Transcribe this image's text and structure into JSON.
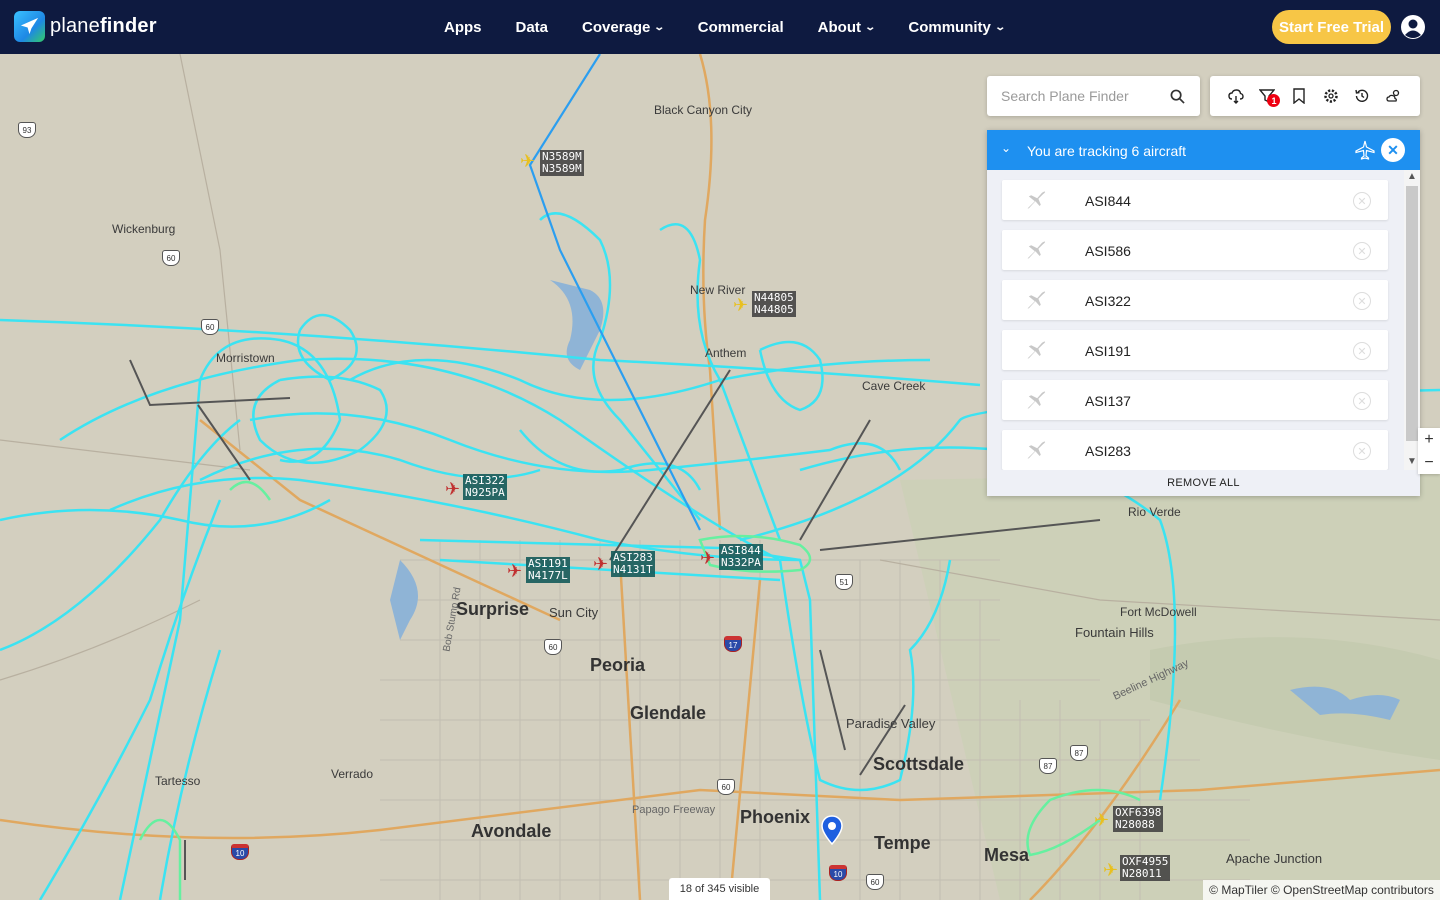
{
  "brand": {
    "name_light": "plane",
    "name_bold": "finder"
  },
  "nav": [
    {
      "label": "Apps",
      "dropdown": false
    },
    {
      "label": "Data",
      "dropdown": false
    },
    {
      "label": "Coverage",
      "dropdown": true
    },
    {
      "label": "Commercial",
      "dropdown": false
    },
    {
      "label": "About",
      "dropdown": true
    },
    {
      "label": "Community",
      "dropdown": true
    }
  ],
  "header": {
    "trial_label": "Start Free Trial"
  },
  "search": {
    "placeholder": "Search Plane Finder"
  },
  "toolbar": {
    "filter_badge": "1",
    "icons": [
      "cloud-icon",
      "filter-icon",
      "bookmark-icon",
      "settings-icon",
      "history-icon",
      "weather-icon"
    ]
  },
  "tracking": {
    "title": "You are tracking 6 aircraft",
    "items": [
      "ASI844",
      "ASI586",
      "ASI322",
      "ASI191",
      "ASI137",
      "ASI283"
    ],
    "remove_all": "REMOVE ALL"
  },
  "zoom": {
    "in": "+",
    "out": "−"
  },
  "map": {
    "places": [
      {
        "name": "Black Canyon City",
        "type": "town"
      },
      {
        "name": "Wickenburg",
        "type": "town"
      },
      {
        "name": "New River",
        "type": "town"
      },
      {
        "name": "Anthem",
        "type": "town"
      },
      {
        "name": "Morristown",
        "type": "town"
      },
      {
        "name": "Cave Creek",
        "type": "town"
      },
      {
        "name": "Rio Verde",
        "type": "town"
      },
      {
        "name": "Fort McDowell",
        "type": "town"
      },
      {
        "name": "Fountain Hills",
        "type": "town"
      },
      {
        "name": "Surprise",
        "type": "city"
      },
      {
        "name": "Sun City",
        "type": "town"
      },
      {
        "name": "Peoria",
        "type": "city"
      },
      {
        "name": "Glendale",
        "type": "city"
      },
      {
        "name": "Paradise Valley",
        "type": "town"
      },
      {
        "name": "Scottsdale",
        "type": "city"
      },
      {
        "name": "Tartesso",
        "type": "town"
      },
      {
        "name": "Verrado",
        "type": "town"
      },
      {
        "name": "Avondale",
        "type": "city"
      },
      {
        "name": "Phoenix",
        "type": "city"
      },
      {
        "name": "Tempe",
        "type": "city"
      },
      {
        "name": "Mesa",
        "type": "city"
      },
      {
        "name": "Apache Junction",
        "type": "town"
      },
      {
        "name": "Papago Freeway",
        "type": "road"
      },
      {
        "name": "Beeline Highway",
        "type": "road"
      },
      {
        "name": "Bob Stump Rd",
        "type": "road"
      }
    ],
    "shields": [
      "93",
      "60",
      "60",
      "51",
      "17",
      "60",
      "87",
      "87",
      "10",
      "10",
      "60",
      "60"
    ],
    "aircraft": [
      {
        "callsign": "N3589M",
        "reg": "N3589M"
      },
      {
        "callsign": "N44805",
        "reg": "N44805"
      },
      {
        "callsign": "ASI322",
        "reg": "N925PA"
      },
      {
        "callsign": "ASI283",
        "reg": "N4131T"
      },
      {
        "callsign": "ASI191",
        "reg": "N4177L"
      },
      {
        "callsign": "ASI844",
        "reg": "N332PA"
      },
      {
        "callsign": "OXF6398",
        "reg": "N28088"
      },
      {
        "callsign": "OXF4955",
        "reg": "N28011"
      }
    ],
    "visible_count": "18 of 345 visible",
    "attribution": "© MapTiler © OpenStreetMap contributors"
  },
  "colors": {
    "header_bg": "#0e1a40",
    "accent": "#1e90f0",
    "trial": "#f7c646",
    "track": "#33e5f5",
    "track_green": "#66f0a0"
  }
}
